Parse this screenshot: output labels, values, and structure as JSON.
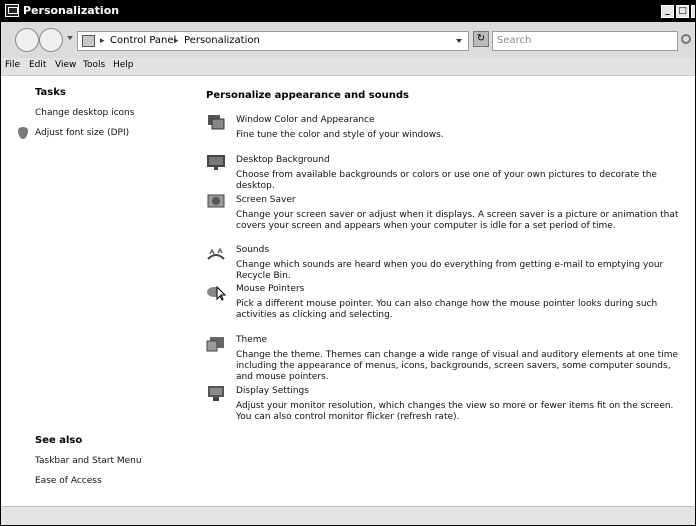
{
  "window": {
    "title": "Personalization",
    "title_buttons": [
      "_",
      "□",
      "✕"
    ]
  },
  "address": {
    "crumbs": [
      "Control Panel",
      "Personalization"
    ],
    "separator": "▸"
  },
  "search": {
    "placeholder": "Search"
  },
  "menu": [
    "File",
    "Edit",
    "View",
    "Tools",
    "Help"
  ],
  "sidebar": {
    "tasks_heading": "Tasks",
    "tasks": [
      "Change desktop icons",
      "Adjust font size (DPI)"
    ],
    "see_also_heading": "See also",
    "see_also": [
      "Taskbar and Start Menu",
      "Ease of Access"
    ]
  },
  "main": {
    "heading": "Personalize appearance and sounds",
    "items": [
      {
        "title": "Window Color and Appearance",
        "desc": "Fine tune the color and style of your windows.",
        "icon": "window-color-icon"
      },
      {
        "title": "Desktop Background",
        "desc": "Choose from available backgrounds or colors or use one of your own pictures to decorate the desktop.",
        "icon": "desktop-background-icon"
      },
      {
        "title": "Screen Saver",
        "desc": "Change your screen saver or adjust when it displays. A screen saver is a picture or animation that covers your screen and appears when your computer is idle for a set period of time.",
        "icon": "screen-saver-icon"
      },
      {
        "title": "Sounds",
        "desc": "Change which sounds are heard when you do everything from getting e-mail to emptying your Recycle Bin.",
        "icon": "sounds-icon"
      },
      {
        "title": "Mouse Pointers",
        "desc": "Pick a different mouse pointer. You can also change how the mouse pointer looks during such activities as clicking and selecting.",
        "icon": "mouse-pointer-icon"
      },
      {
        "title": "Theme",
        "desc": "Change the theme. Themes can change a wide range of visual and auditory elements at one time including the appearance of menus, icons, backgrounds, screen savers, some computer sounds, and mouse pointers.",
        "icon": "theme-icon"
      },
      {
        "title": "Display Settings",
        "desc": "Adjust your monitor resolution, which changes the view so more or fewer items fit on the screen. You can also control monitor flicker (refresh rate).",
        "icon": "display-settings-icon"
      }
    ]
  }
}
